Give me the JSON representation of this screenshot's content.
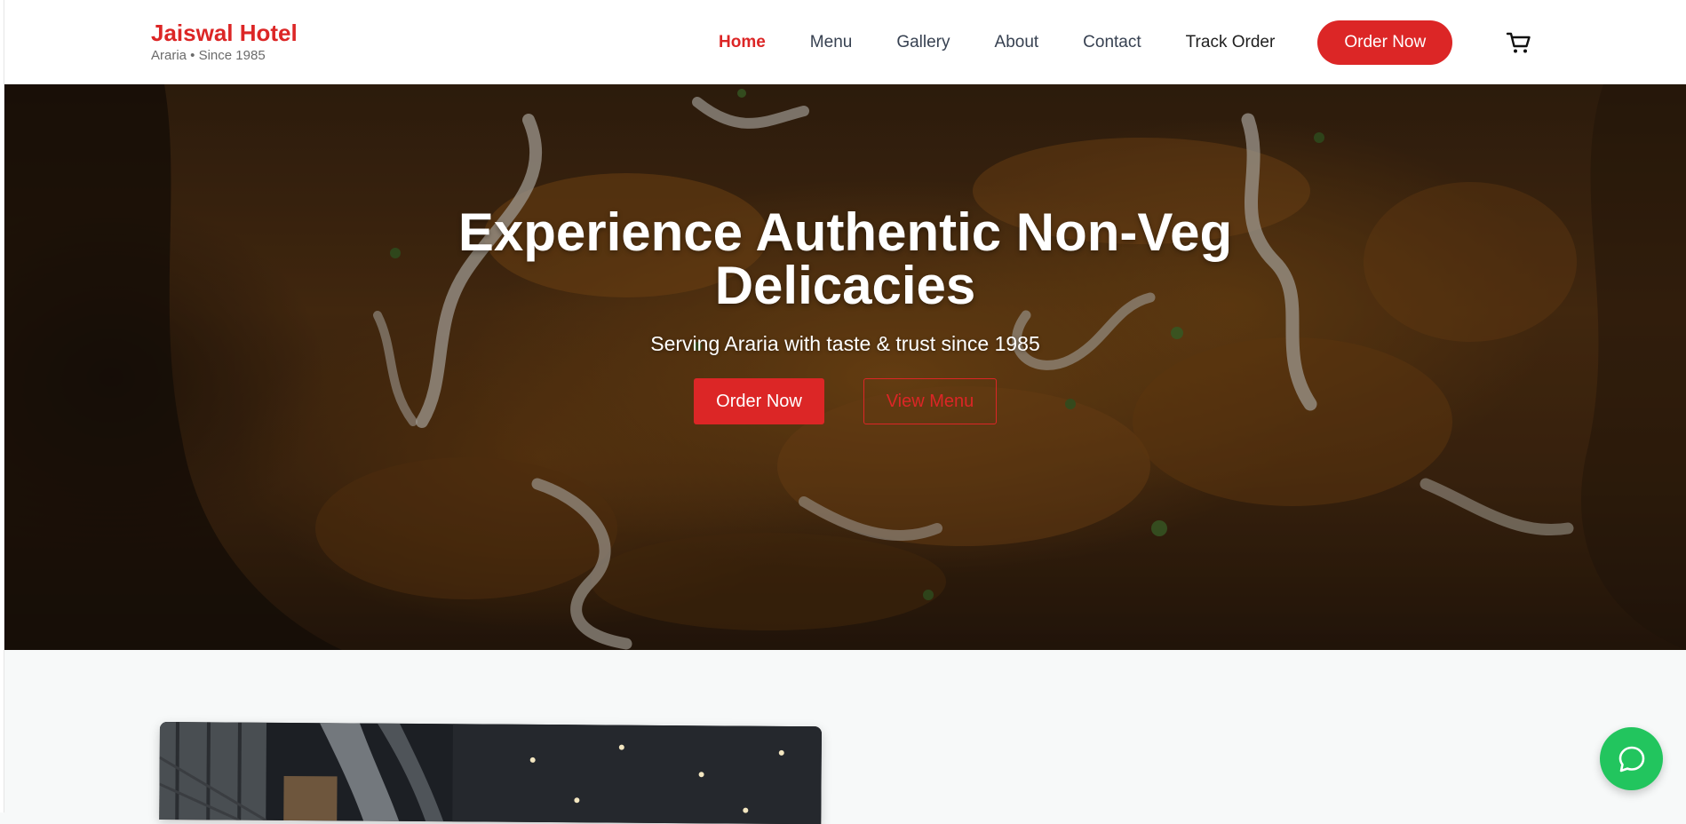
{
  "header": {
    "brand_name": "Jaiswal Hotel",
    "brand_tagline": "Araria • Since 1985",
    "nav": {
      "home": "Home",
      "menu": "Menu",
      "gallery": "Gallery",
      "about": "About",
      "contact": "Contact",
      "track_order": "Track Order"
    },
    "order_button": "Order Now",
    "cart_icon": "shopping-cart-icon"
  },
  "hero": {
    "title": "Experience Authentic Non-Veg Delicacies",
    "subtitle": "Serving Araria with taste & trust since 1985",
    "primary_button": "Order Now",
    "secondary_button": "View Menu"
  },
  "chat": {
    "icon": "chat-bubble-icon"
  },
  "colors": {
    "accent": "#dc2626",
    "chat": "#22c55e",
    "page_bg": "#f7f9f9"
  }
}
